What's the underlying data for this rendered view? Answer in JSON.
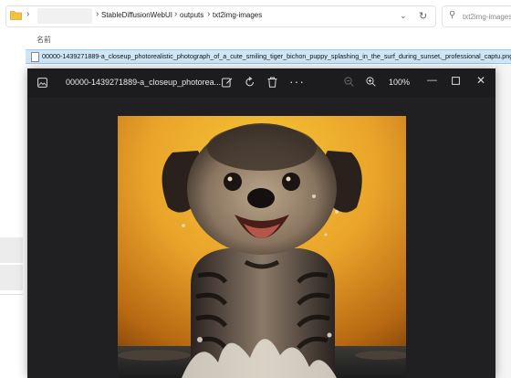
{
  "explorer": {
    "breadcrumbs": [
      "StableDiffusionWebUI",
      "outputs",
      "txt2img-images"
    ],
    "search_placeholder": "txt2img-images",
    "column_header": "名前",
    "selected_file": "00000-1439271889-a_closeup_photorealistic_photograph_of_a_cute_smiling_tiger_bichon_puppy_splashing_in_the_surf_during_sunset,_professional_captu.png",
    "icons": {
      "folder": "folder-icon",
      "chevron": "chevron-right-icon",
      "dropdown": "chevron-down-icon",
      "refresh": "refresh-icon",
      "search": "search-icon"
    }
  },
  "viewer": {
    "title": "00000-1439271889-a_closeup_photorea...",
    "zoom": "100%",
    "toolbar_icons": [
      "image-icon",
      "edit-image-icon",
      "rotate-icon",
      "delete-icon",
      "more-icon",
      "zoom-out-icon",
      "zoom-in-icon",
      "minimize-icon",
      "maximize-icon",
      "close-icon"
    ],
    "colors": {
      "background": "#202022",
      "titlebar": "#1c1c1e",
      "accent": "#9ccaf0"
    }
  }
}
